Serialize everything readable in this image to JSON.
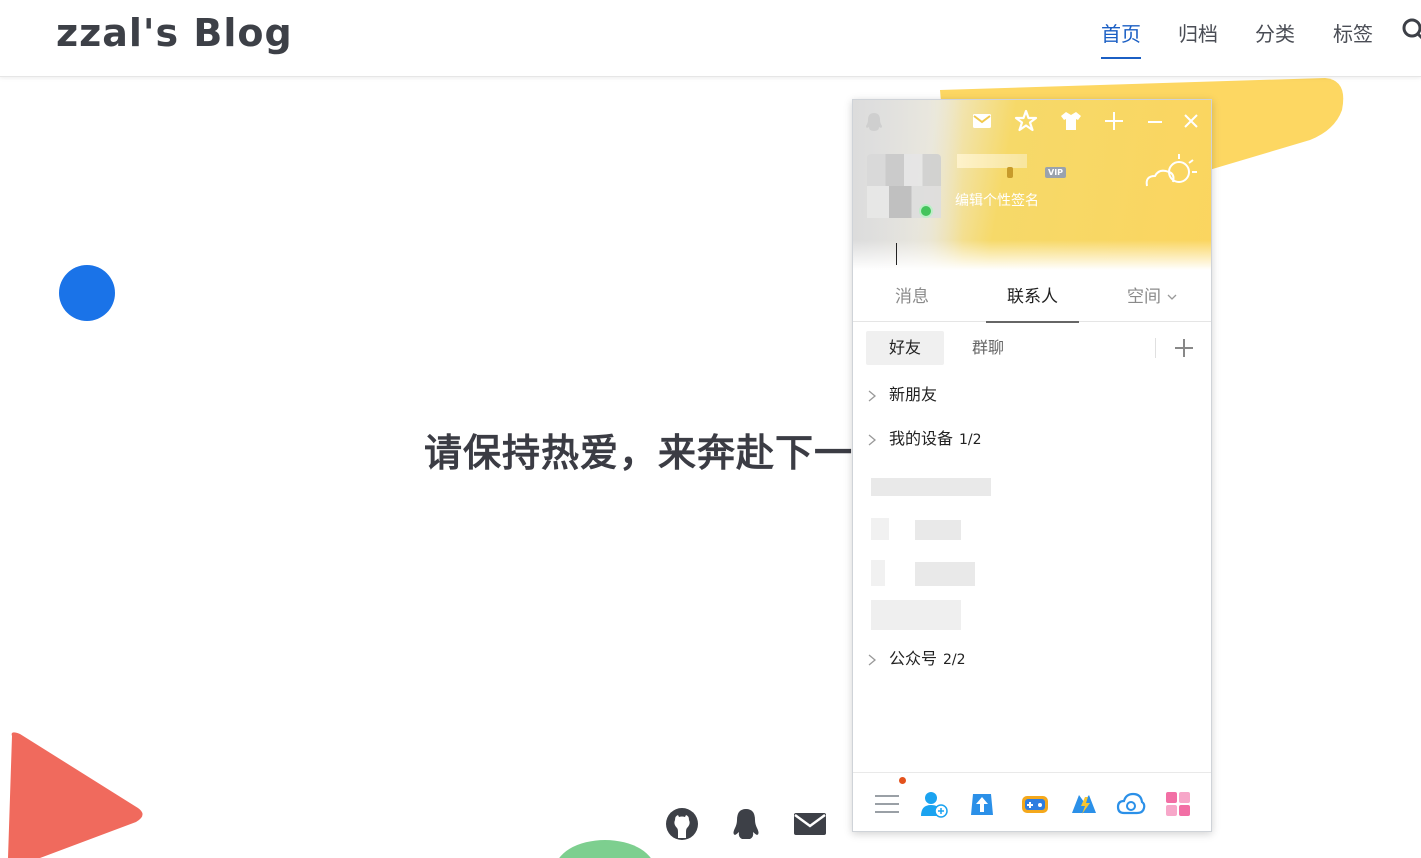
{
  "blog": {
    "title": "zzal's Blog",
    "nav": [
      "首页",
      "归档",
      "分类",
      "标签"
    ],
    "active_nav": "首页",
    "slogan": "请保持热爱，来奔赴下一场山和海！"
  },
  "qq": {
    "level_badge": "",
    "vip_badge": "VIP",
    "signature": "编辑个性签名",
    "tabs": [
      {
        "label": "消息"
      },
      {
        "label": "联系人"
      },
      {
        "label": "空间"
      }
    ],
    "active_tab": "联系人",
    "subtabs": [
      {
        "label": "好友"
      },
      {
        "label": "群聊"
      }
    ],
    "active_subtab": "好友",
    "groups": [
      {
        "label": "新朋友",
        "count": ""
      },
      {
        "label": "我的设备",
        "count": "1/2"
      },
      {
        "label": "公众号",
        "count": "2/2"
      }
    ]
  },
  "colors": {
    "accent_blue": "#1b5fc4",
    "deco_blue": "#1a73e8",
    "deco_yellow": "#fdd762",
    "deco_red": "#f06a5d",
    "deco_green": "#7dcf8f"
  }
}
